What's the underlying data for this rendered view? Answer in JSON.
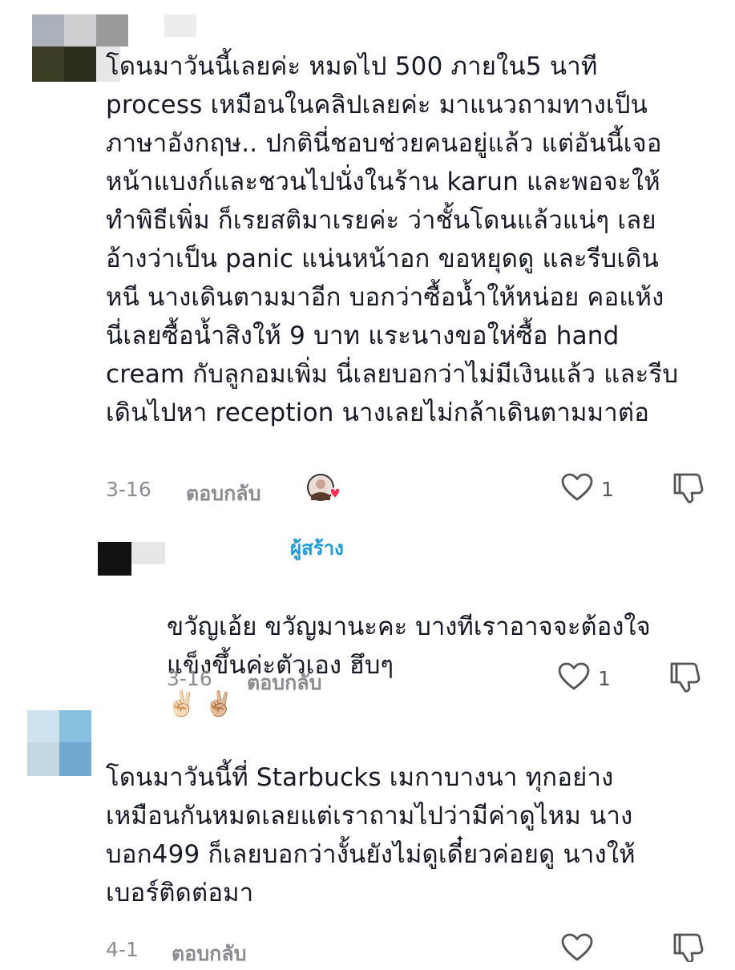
{
  "comments": [
    {
      "text": "โดนมาวันนี้เลยค่ะ หมดไป 500 ภายใน5 นาที\nprocess เหมือนในคลิปเลยค่ะ มาแนวถามทางเป็น\nภาษาอังกฤษ.. ปกตินี่ชอบช่วยคนอยู่แล้ว แต่อันนี้เจอ\nหน้าแบงก์และชวนไปนั่งในร้าน karun และพอจะให้\nทำพิธีเพิ่ม ก็เรยสติมาเรยค่ะ ว่าชั้นโดนแล้วแน่ๆ เลย\nอ้างว่าเป็น panic แน่นหน้าอก ขอหยุดดู และรีบเดิน\nหนี นางเดินตามมาอีก บอกว่าซื้อน้ำให้หน่อย คอแห้ง\nนี่เลยซื้อน้ำสิงให้ 9 บาท แระนางขอให่ซื้อ hand\ncream กับลูกอมเพิ่ม นี่เลยบอกว่าไม่มีเงินแล้ว และรีบ\nเดินไปหา reception นางเลยไม่กล้าเดินตามมาต่อ",
      "date": "3-16",
      "reply_label": "ตอบกลับ",
      "likes": "1",
      "reply": {
        "creator_label": "ผู้สร้าง",
        "text": "ขวัญเอ้ย ขวัญมานะคะ บางทีเราอาจจะต้องใจ\nแข็งขึ้นค่ะตัวเอง ฮึบๆ",
        "emojis": "✌🏻 ✌🏼",
        "date": "3-16",
        "reply_label": "ตอบกลับ",
        "likes": "1"
      }
    },
    {
      "text": "โดนมาวันนี้ที่ Starbucks เมกาบางนา ทุกอย่าง\nเหมือนกันหมดเลยแต่เราถามไปว่ามีค่าดูไหม นาง\nบอก499 ก็เลยบอกว่างั้นยังไม่ดูเดี๋ยวค่อยดู นางให้\nเบอร์ติดต่อมา",
      "date": "4-1",
      "reply_label": "ตอบกลับ"
    }
  ],
  "icons": {
    "like": "heart-outline-icon",
    "dislike": "thumbs-down-icon",
    "creator_liked": "creator-liked-heart-icon"
  },
  "colors": {
    "creator_label": "#1d9bd8",
    "meta": "#8a8b91",
    "heart_badge": "#fe2c55"
  }
}
